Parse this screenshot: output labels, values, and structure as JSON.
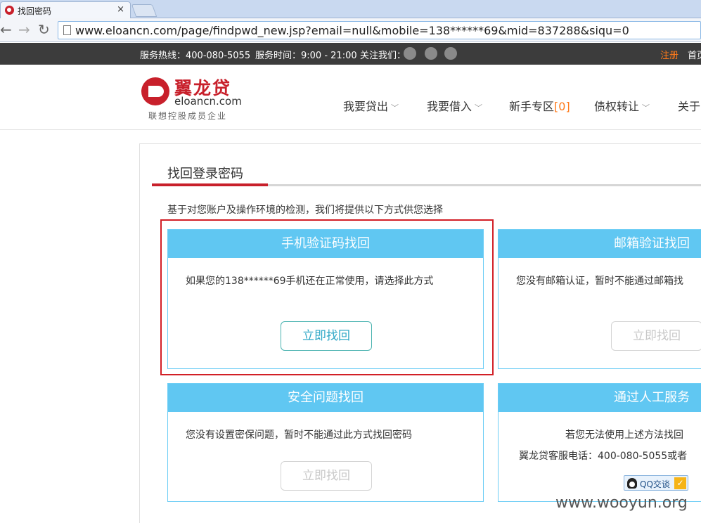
{
  "browser": {
    "tab_title": "找回密码",
    "tab_close": "×",
    "nav_back": "←",
    "nav_forward": "→",
    "nav_reload": "↻",
    "url": "www.eloancn.com/page/findpwd_new.jsp?email=null&mobile=138******69&mid=837288&siqu=0"
  },
  "topbar": {
    "hotline": "服务热线：400-080-5055",
    "hours": "服务时间：9:00 - 21:00",
    "follow": "关注我们：",
    "register": "注册",
    "home": "首页"
  },
  "header": {
    "logo_cn": "翼龙贷",
    "logo_en": "eloancn.com",
    "logo_sub": "联想控股成员企业",
    "menu": [
      {
        "label": "我要贷出",
        "chevron": "﹀"
      },
      {
        "label": "我要借入",
        "chevron": "﹀"
      },
      {
        "label": "新手专区",
        "badge": "[0]"
      },
      {
        "label": "债权转让",
        "chevron": "﹀"
      },
      {
        "label": "关于"
      }
    ]
  },
  "main": {
    "title": "找回登录密码",
    "intro": "基于对您账户及操作环境的检测，我们将提供以下方式供您选择",
    "cards": [
      {
        "title": "手机验证码找回",
        "text": "如果您的138******69手机还在正常使用，请选择此方式",
        "button": "立即找回",
        "enabled": true
      },
      {
        "title": "邮箱验证找回",
        "text": "您没有邮箱认证，暂时不能通过邮箱找",
        "button": "立即找回",
        "enabled": false
      },
      {
        "title": "安全问题找回",
        "text": "您没有设置密保问题，暂时不能通过此方式找回密码",
        "button": "立即找回",
        "enabled": false
      },
      {
        "title": "通过人工服务",
        "text": "若您无法使用上述方法找回",
        "text2": "翼龙贷客服电话：400-080-5055或者",
        "qq_label": "QQ交谈",
        "qq_check": "✓"
      }
    ]
  },
  "watermark": "www.wooyun.org"
}
